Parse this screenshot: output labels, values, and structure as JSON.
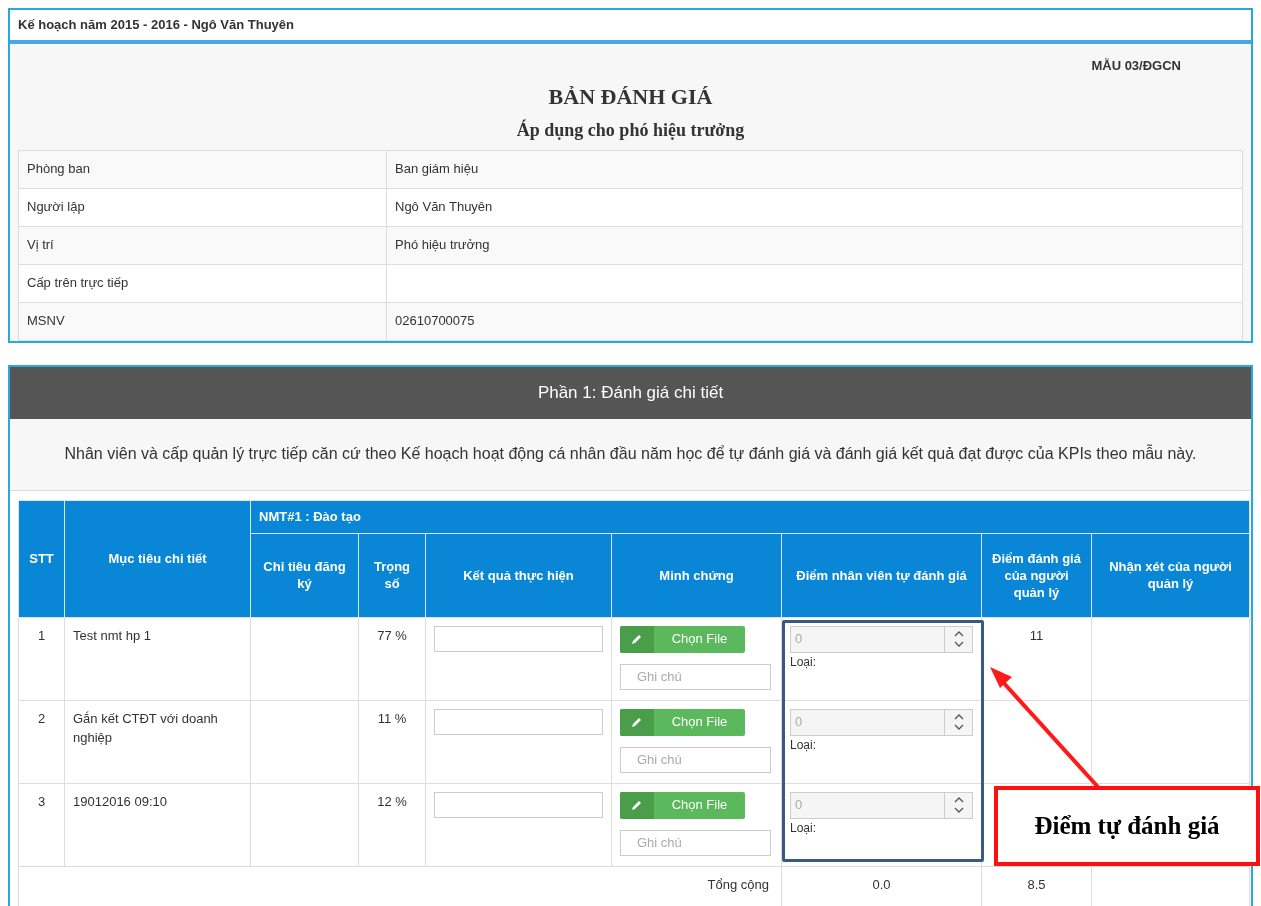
{
  "panel_title": "Kế hoạch năm 2015 - 2016 - Ngô Văn Thuyên",
  "form_code": "MẪU 03/ĐGCN",
  "title": "BẢN ĐÁNH GIÁ",
  "subtitle": "Áp dụng cho phó hiệu trưởng",
  "info_rows": [
    {
      "label": "Phòng ban",
      "value": "Ban giám hiệu"
    },
    {
      "label": "Người lập",
      "value": "Ngô Văn Thuyên"
    },
    {
      "label": "Vị trí",
      "value": "Phó hiệu trưởng"
    },
    {
      "label": "Cấp trên trực tiếp"
    },
    {
      "label": "MSNV",
      "value": "02610700075"
    }
  ],
  "section": {
    "title": "Phần 1: Đánh giá chi tiết",
    "description": "Nhân viên và cấp quản lý trực tiếp căn cứ theo Kế hoạch hoạt động cá nhân đầu năm học để tự đánh giá và đánh giá kết quả đạt được của KPIs theo mẫu này."
  },
  "table": {
    "group_header": "NMT#1 : Đào tạo",
    "columns": [
      "STT",
      "Mục tiêu chi tiết",
      "Chỉ tiêu đăng ký",
      "Trọng số",
      "Kết quả thực hiện",
      "Minh chứng",
      "Điểm nhân viên tự đánh giá",
      "Điểm đánh giá của người quản lý",
      "Nhận xét của người quản lý"
    ],
    "rows": [
      {
        "stt": "1",
        "goal": "Test nmt hp 1",
        "weight": "77 %",
        "file_button": "Chọn File",
        "note_placeholder": "Ghi chú",
        "self_score_placeholder": "0",
        "type_label": "Loại:",
        "manager_score": "11"
      },
      {
        "stt": "2",
        "goal": "Gắn kết CTĐT với doanh nghiệp",
        "weight": "11 %",
        "file_button": "Chọn File",
        "note_placeholder": "Ghi chú",
        "self_score_placeholder": "0",
        "type_label": "Loại:"
      },
      {
        "stt": "3",
        "goal": "19012016 09:10",
        "weight": "12 %",
        "file_button": "Chọn File",
        "note_placeholder": "Ghi chú",
        "self_score_placeholder": "0",
        "type_label": "Loại:"
      }
    ],
    "total": {
      "label": "Tổng cộng",
      "self_score": "0.0",
      "manager_score": "8.5"
    }
  },
  "callout": {
    "text": "Điểm tự đánh giá"
  }
}
